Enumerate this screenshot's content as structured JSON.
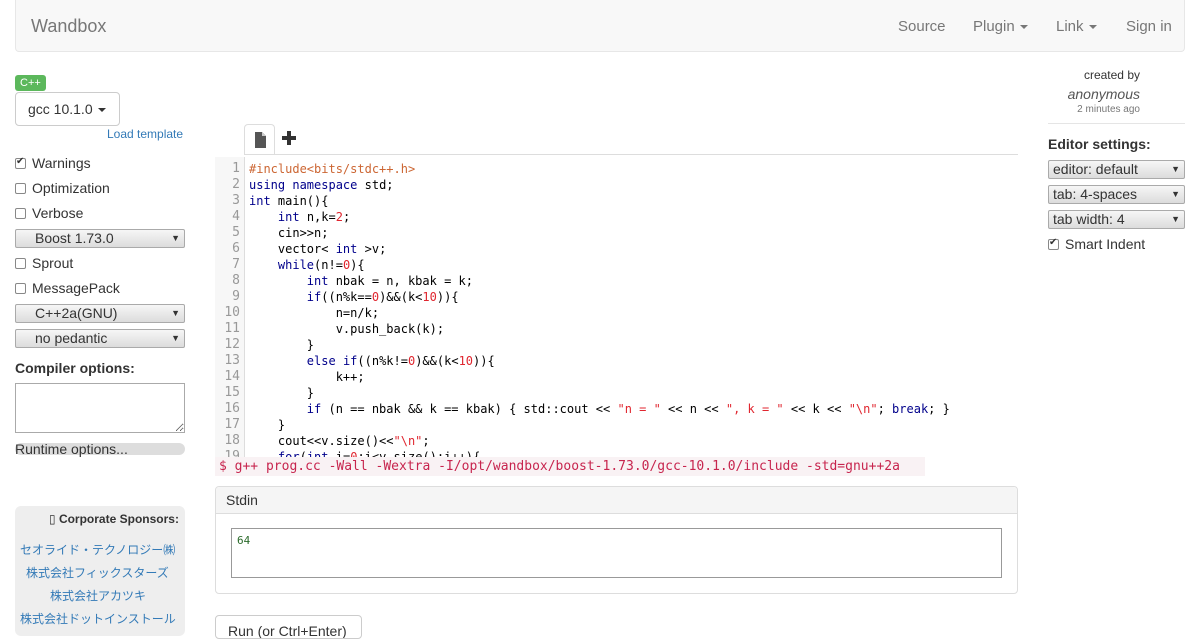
{
  "navbar": {
    "brand": "Wandbox",
    "source": "Source",
    "plugin": "Plugin",
    "link": "Link",
    "sign_in": "Sign in"
  },
  "language_badge": "C++",
  "compiler": {
    "selected": "gcc 10.1.0",
    "load_template": "Load template"
  },
  "options": {
    "warnings": {
      "label": "Warnings",
      "checked": true
    },
    "optimization": {
      "label": "Optimization",
      "checked": false
    },
    "verbose": {
      "label": "Verbose",
      "checked": false
    },
    "boost": "Boost 1.73.0",
    "sprout": {
      "label": "Sprout",
      "checked": false
    },
    "messagepack": {
      "label": "MessagePack",
      "checked": false
    },
    "std": "C++2a(GNU)",
    "pedantic": "no pedantic",
    "compiler_options_label": "Compiler options:",
    "runtime_options": "Runtime options..."
  },
  "sponsors": {
    "title": "Corporate Sponsors:",
    "items": [
      "セオライド・テクノロジー㈱",
      "株式会社フィックスターズ",
      "株式会社アカツキ",
      "株式会社ドットインストール"
    ]
  },
  "editor": {
    "line_numbers": [
      "1",
      "2",
      "3",
      "4",
      "5",
      "6",
      "7",
      "8",
      "9",
      "10",
      "11",
      "12",
      "13",
      "14",
      "15",
      "16",
      "17",
      "18",
      "19"
    ]
  },
  "command_line": "$ g++ prog.cc -Wall -Wextra -I/opt/wandbox/boost-1.73.0/gcc-10.1.0/include -std=gnu++2a",
  "stdin": {
    "title": "Stdin",
    "value": "64"
  },
  "run_button": "Run (or Ctrl+Enter)",
  "author_info": {
    "created_by": "created by",
    "author": "anonymous",
    "time_ago": "2 minutes ago"
  },
  "editor_settings": {
    "label": "Editor settings:",
    "editor_mode": "editor: default",
    "tab": "tab: 4-spaces",
    "tab_width": "tab width: 4",
    "smart_indent": {
      "label": "Smart Indent",
      "checked": true
    }
  }
}
